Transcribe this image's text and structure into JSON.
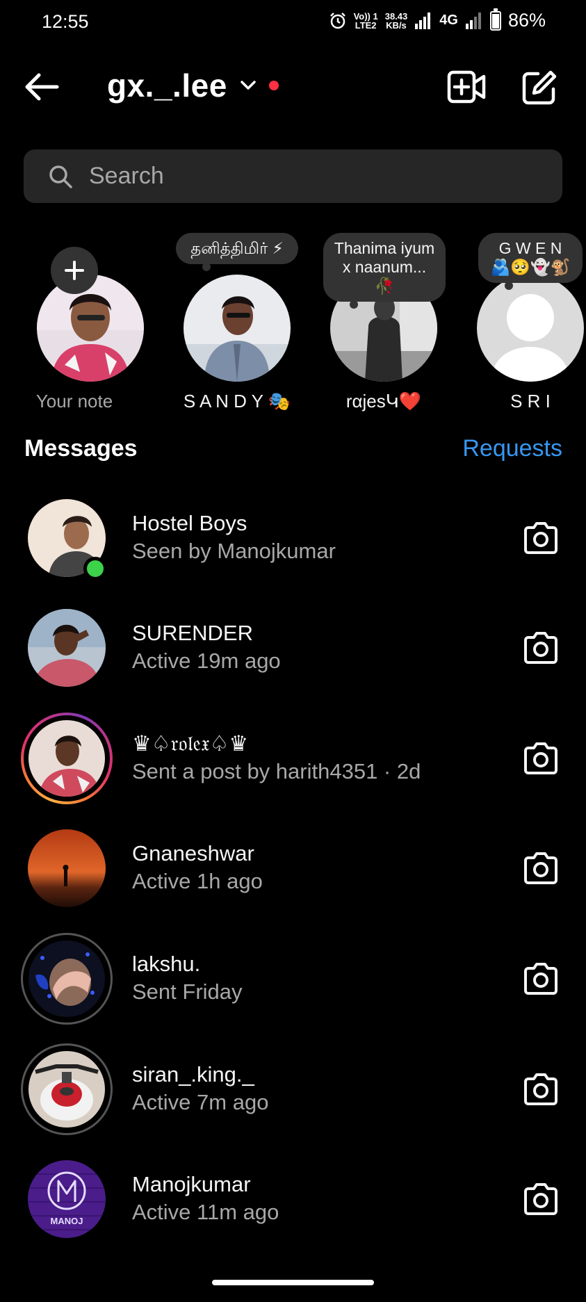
{
  "status_bar": {
    "time": "12:55",
    "volte_top": "Vo)) 1",
    "volte_bottom": "LTE2",
    "speed_top": "38.43",
    "speed_bottom": "KB/s",
    "network": "4G",
    "battery_percent": "86%",
    "battery_level": 0.86,
    "icons": [
      "alarm-icon",
      "signal-icon",
      "signal-icon",
      "battery-icon"
    ]
  },
  "header": {
    "account_name": "gx._.lee",
    "icons": [
      "back-arrow-icon",
      "chevron-down-icon",
      "video-plus-icon",
      "compose-icon"
    ]
  },
  "search": {
    "placeholder": "Search"
  },
  "notes": [
    {
      "label": "Your note",
      "bubble": "",
      "add_icon": "plus-icon"
    },
    {
      "label": "S A N D Y 🎭",
      "bubble": "தனித்திமிர் ⚡"
    },
    {
      "label": "rαjesԿ❤️",
      "bubble": "Thanima iyum x naanum...🥀"
    },
    {
      "label": "S R I",
      "bubble": "G W E N 🫂🥺👻🐒"
    }
  ],
  "messages": {
    "title": "Messages",
    "requests_label": "Requests"
  },
  "threads": [
    {
      "name": "Hostel Boys",
      "subtitle": "Seen by Manojkumar",
      "online": true
    },
    {
      "name": "SURENDER",
      "subtitle": "Active 19m ago"
    },
    {
      "name": "♛♤𝔯𝔬𝔩𝔢𝔵♤♛",
      "subtitle": "Sent a post by harith4351 · 2d",
      "story_ring": true
    },
    {
      "name": "Gnaneshwar",
      "subtitle": "Active 1h ago"
    },
    {
      "name": "lakshu.",
      "subtitle": "Sent Friday",
      "seen_ring": true
    },
    {
      "name": "siran_.king._",
      "subtitle": "Active 7m ago",
      "seen_ring": true
    },
    {
      "name": "Manojkumar",
      "subtitle": "Active 11m ago",
      "avatar_text": "MANOJ"
    }
  ],
  "colors": {
    "background": "#000000",
    "search_bg": "#262626",
    "requests_blue": "#3797f0",
    "online_green": "#3cd24a",
    "notification_red": "#ff3040",
    "secondary_text": "#a8a8a8"
  }
}
